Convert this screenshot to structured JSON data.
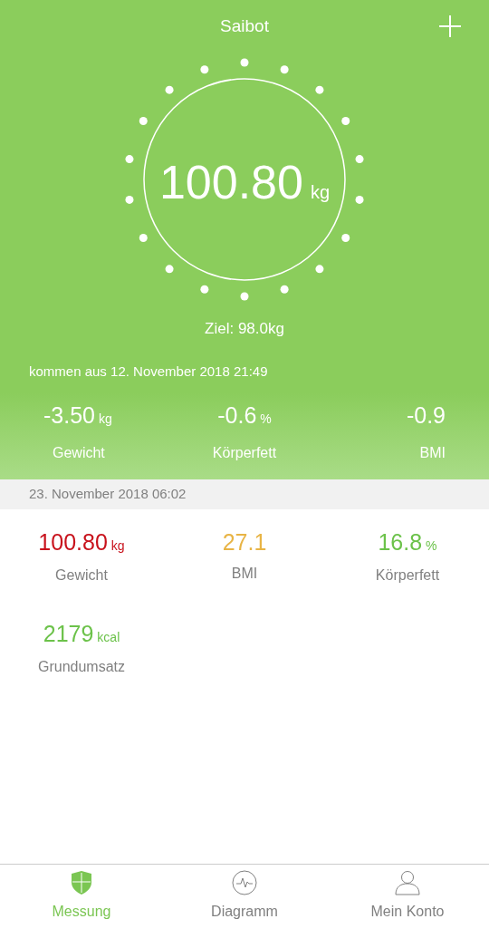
{
  "header": {
    "title": "Saibot"
  },
  "dial": {
    "value": "100.80",
    "unit": "kg"
  },
  "goal": "Ziel: 98.0kg",
  "since": "kommen aus 12. November 2018 21:49",
  "changes": [
    {
      "value": "-3.50",
      "unit": "kg",
      "label": "Gewicht"
    },
    {
      "value": "-0.6",
      "unit": "%",
      "label": "Körperfett"
    },
    {
      "value": "-0.9",
      "label": "BMI"
    }
  ],
  "date": "23. November 2018 06:02",
  "metrics": [
    {
      "value": "100.80",
      "unit": "kg",
      "label": "Gewicht",
      "color": "#c8121c"
    },
    {
      "value": "27.1",
      "label": "BMI",
      "color": "#e8b445"
    },
    {
      "value": "16.8",
      "unit": "%",
      "label": "Körperfett",
      "color": "#6cc24a"
    },
    {
      "value": "2179",
      "unit": "kcal",
      "label": "Grundumsatz",
      "color": "#6cc24a"
    }
  ],
  "nav": [
    {
      "label": "Messung",
      "selected": true
    },
    {
      "label": "Diagramm",
      "selected": false
    },
    {
      "label": "Mein Konto",
      "selected": false
    }
  ]
}
